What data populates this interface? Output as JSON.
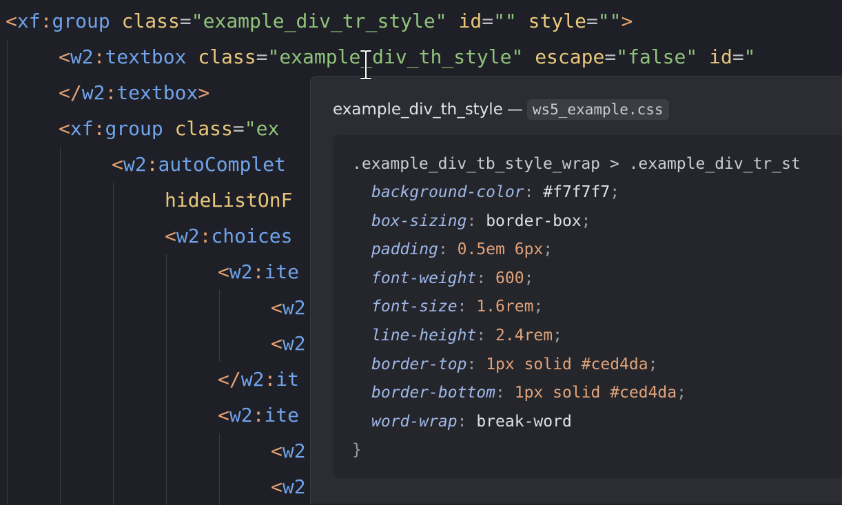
{
  "code_lines": [
    {
      "indent": 0,
      "tokens": [
        [
          "tag",
          "<"
        ],
        [
          "ns",
          "xf"
        ],
        [
          "tag",
          ":"
        ],
        [
          "name",
          "group"
        ],
        [
          "text",
          " "
        ],
        [
          "attr",
          "class"
        ],
        [
          "text",
          "="
        ],
        [
          "str",
          "\"example_div_tr_style\""
        ],
        [
          "text",
          " "
        ],
        [
          "attr",
          "id"
        ],
        [
          "text",
          "="
        ],
        [
          "str",
          "\"\""
        ],
        [
          "text",
          " "
        ],
        [
          "attr",
          "style"
        ],
        [
          "text",
          "="
        ],
        [
          "str",
          "\"\""
        ],
        [
          "tag",
          ">"
        ]
      ]
    },
    {
      "indent": 1,
      "tokens": [
        [
          "tag",
          "<"
        ],
        [
          "ns",
          "w2"
        ],
        [
          "tag",
          ":"
        ],
        [
          "name",
          "textbox"
        ],
        [
          "text",
          " "
        ],
        [
          "attr",
          "class"
        ],
        [
          "text",
          "="
        ],
        [
          "str",
          "\"example_div_th_style\""
        ],
        [
          "text",
          " "
        ],
        [
          "attr",
          "escape"
        ],
        [
          "text",
          "="
        ],
        [
          "str",
          "\"false\""
        ],
        [
          "text",
          " "
        ],
        [
          "attr",
          "id"
        ],
        [
          "text",
          "="
        ],
        [
          "str",
          "\""
        ]
      ]
    },
    {
      "indent": 1,
      "tokens": [
        [
          "tag",
          "</"
        ],
        [
          "ns",
          "w2"
        ],
        [
          "tag",
          ":"
        ],
        [
          "name",
          "textbox"
        ],
        [
          "tag",
          ">"
        ]
      ]
    },
    {
      "indent": 1,
      "tokens": [
        [
          "tag",
          "<"
        ],
        [
          "ns",
          "xf"
        ],
        [
          "tag",
          ":"
        ],
        [
          "name",
          "group"
        ],
        [
          "text",
          " "
        ],
        [
          "attr",
          "class"
        ],
        [
          "text",
          "="
        ],
        [
          "str",
          "\"ex"
        ]
      ]
    },
    {
      "indent": 2,
      "tokens": [
        [
          "tag",
          "<"
        ],
        [
          "ns",
          "w2"
        ],
        [
          "tag",
          ":"
        ],
        [
          "name",
          "autoComplet"
        ]
      ]
    },
    {
      "indent": 3,
      "tokens": [
        [
          "attr",
          "hideListOnF"
        ]
      ]
    },
    {
      "indent": 3,
      "tokens": [
        [
          "tag",
          "<"
        ],
        [
          "ns",
          "w2"
        ],
        [
          "tag",
          ":"
        ],
        [
          "name",
          "choices"
        ]
      ]
    },
    {
      "indent": 4,
      "tokens": [
        [
          "tag",
          "<"
        ],
        [
          "ns",
          "w2"
        ],
        [
          "tag",
          ":"
        ],
        [
          "name",
          "ite"
        ]
      ]
    },
    {
      "indent": 5,
      "tokens": [
        [
          "tag",
          "<"
        ],
        [
          "ns",
          "w2"
        ]
      ]
    },
    {
      "indent": 5,
      "tokens": [
        [
          "tag",
          "<"
        ],
        [
          "ns",
          "w2"
        ]
      ]
    },
    {
      "indent": 4,
      "tokens": [
        [
          "tag",
          "</"
        ],
        [
          "ns",
          "w2"
        ],
        [
          "tag",
          ":"
        ],
        [
          "name",
          "it"
        ]
      ]
    },
    {
      "indent": 4,
      "tokens": [
        [
          "tag",
          "<"
        ],
        [
          "ns",
          "w2"
        ],
        [
          "tag",
          ":"
        ],
        [
          "name",
          "ite"
        ]
      ]
    },
    {
      "indent": 5,
      "tokens": [
        [
          "tag",
          "<"
        ],
        [
          "ns",
          "w2"
        ]
      ]
    },
    {
      "indent": 5,
      "tokens": [
        [
          "tag",
          "<"
        ],
        [
          "ns",
          "w2"
        ]
      ]
    }
  ],
  "popup": {
    "title": "example_div_th_style",
    "separator": "—",
    "file": "ws5_example.css",
    "selector": ".example_div_tb_style_wrap > .example_div_tr_st",
    "declarations": [
      {
        "prop": "background-color",
        "value": "#f7f7f7",
        "end": ";"
      },
      {
        "prop": "box-sizing",
        "value": "border-box",
        "end": ";"
      },
      {
        "prop": "padding",
        "value": "0.5em 6px",
        "end": ";"
      },
      {
        "prop": "font-weight",
        "value": "600",
        "end": ";"
      },
      {
        "prop": "font-size",
        "value": "1.6rem",
        "end": ";"
      },
      {
        "prop": "line-height",
        "value": "2.4rem",
        "end": ";"
      },
      {
        "prop": "border-top",
        "value": "1px solid #ced4da",
        "end": ";"
      },
      {
        "prop": "border-bottom",
        "value": "1px solid #ced4da",
        "end": ";"
      },
      {
        "prop": "word-wrap",
        "value": "break-word",
        "end": ""
      }
    ],
    "closing_brace": "}"
  },
  "cursor_icon": "text-cursor-icon"
}
